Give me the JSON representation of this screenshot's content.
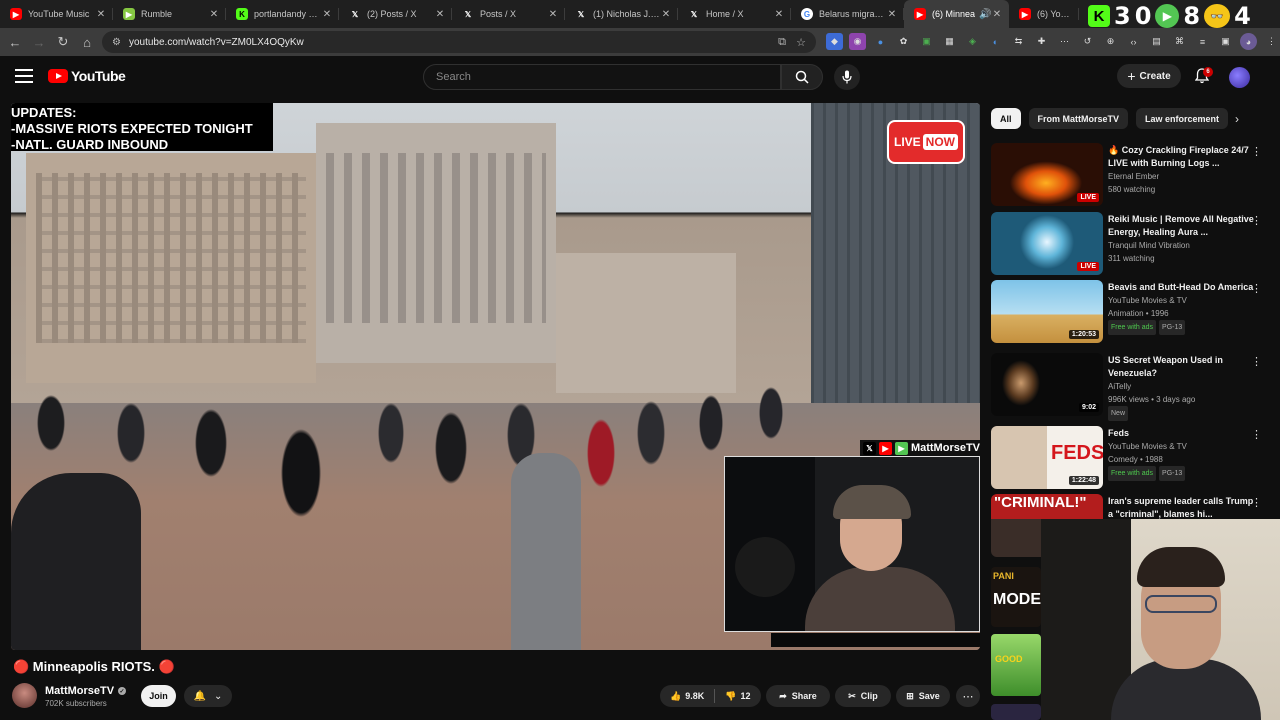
{
  "browser": {
    "tabs": [
      {
        "title": "YouTube Music",
        "favicon": "youtube-music-icon",
        "color": "#ff0000"
      },
      {
        "title": "Rumble",
        "favicon": "rumble-icon",
        "color": "#85c742"
      },
      {
        "title": "portlandandy Stre",
        "favicon": "kick-icon",
        "color": "#53fc18"
      },
      {
        "title": "(2) Posts / X",
        "favicon": "x-icon",
        "color": "#000000"
      },
      {
        "title": "Posts / X",
        "favicon": "x-icon",
        "color": "#000000"
      },
      {
        "title": "(1) Nicholas J. Fue",
        "favicon": "x-icon",
        "color": "#000000"
      },
      {
        "title": "Home / X",
        "favicon": "x-icon",
        "color": "#000000"
      },
      {
        "title": "Belarus migrant -",
        "favicon": "google-icon",
        "color": "#4285f4"
      },
      {
        "title": "(6) Minnea",
        "favicon": "youtube-icon",
        "color": "#ff0000",
        "active": true
      },
      {
        "title": "(6) YouTube",
        "favicon": "youtube-icon",
        "color": "#ff0000"
      }
    ],
    "extra_num_1": "3",
    "extra_num_2": "0",
    "extra_num_3": "8",
    "extra_num_4": "4",
    "url": "youtube.com/watch?v=ZM0LX4OQyKw"
  },
  "youtube": {
    "logo_text": "YouTube",
    "search_placeholder": "Search",
    "create_label": "Create",
    "notif_count": "6"
  },
  "video": {
    "overlay_line1": "UPDATES:",
    "overlay_line2": "-MASSIVE RIOTS EXPECTED TONIGHT",
    "overlay_line3": "-NATL. GUARD INBOUND",
    "live_text": "LIVE",
    "now_text": "NOW",
    "pip_channel": "MattMorseTV",
    "title": "🔴 Minneapolis RIOTS. 🔴",
    "channel": "MattMorseTV",
    "subscribers": "702K subscribers",
    "join_label": "Join",
    "likes": "9.8K",
    "dislikes": "12",
    "share_label": "Share",
    "clip_label": "Clip",
    "save_label": "Save"
  },
  "sidebar": {
    "chips": [
      "All",
      "From MattMorseTV",
      "Law enforcement"
    ],
    "recommendations": [
      {
        "title": "🔥 Cozy Crackling Fireplace 24/7 LIVE with Burning Logs ...",
        "channel": "Eternal Ember",
        "meta": "580 watching",
        "badge": "LIVE"
      },
      {
        "title": "Reiki Music | Remove All Negative Energy, Healing Aura ...",
        "channel": "Tranquil Mind Vibration",
        "meta": "311 watching",
        "badge": "LIVE"
      },
      {
        "title": "Beavis and Butt-Head Do America",
        "channel": "YouTube Movies & TV",
        "meta": "Animation • 1996",
        "duration": "1:20:53",
        "free": "Free with ads",
        "rating": "PG-13"
      },
      {
        "title": "US Secret Weapon Used in Venezuela?",
        "channel": "AiTelly",
        "meta": "996K views • 3 days ago",
        "duration": "9:02",
        "tag": "New"
      },
      {
        "title": "Feds",
        "channel": "YouTube Movies & TV",
        "meta": "Comedy • 1988",
        "duration": "1:22:48",
        "free": "Free with ads",
        "rating": "PG-13"
      },
      {
        "title": "Iran's supreme leader calls Trump a \"criminal\", blames hi..."
      }
    ]
  }
}
